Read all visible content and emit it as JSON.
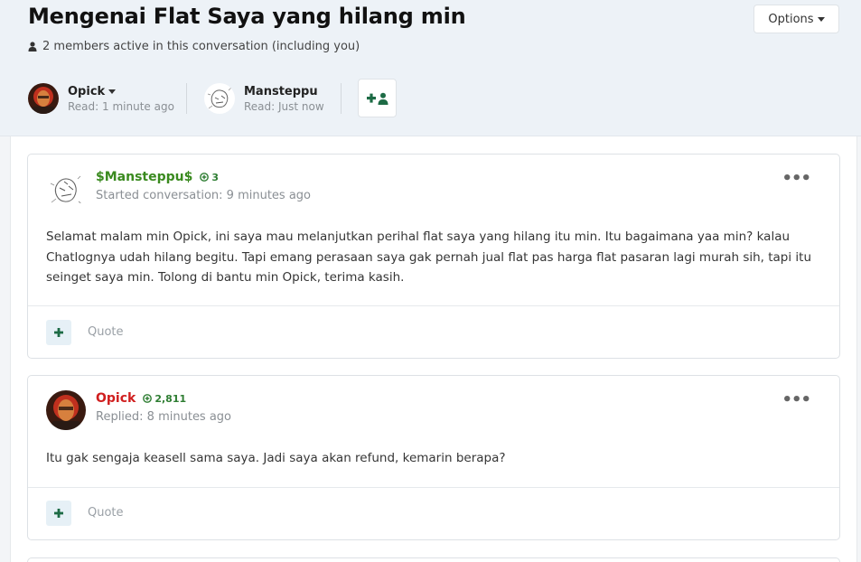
{
  "conversation": {
    "title": "Mengenai Flat Saya yang hilang min",
    "options_label": "Options",
    "active_members": "2 members active in this conversation (including you)",
    "members": [
      {
        "name": "Opick",
        "read": "Read: 1 minute ago"
      },
      {
        "name": "Mansteppu",
        "read": "Read: Just now"
      }
    ]
  },
  "messages": [
    {
      "author": "$Mansteppu$",
      "author_color": "#3a8a1f",
      "reputation": "3",
      "meta": "Started conversation: 9 minutes ago",
      "body": "Selamat malam min Opick, ini saya mau melanjutkan perihal flat saya yang hilang itu min. Itu bagaimana yaa min? kalau Chatlognya udah hilang begitu. Tapi emang perasaan saya gak pernah jual flat pas harga flat pasaran lagi murah sih, tapi itu seinget saya min. Tolong di bantu min Opick, terima kasih.",
      "quote_label": "Quote"
    },
    {
      "author": "Opick",
      "author_color": "#d01f1f",
      "reputation": "2,811",
      "meta": "Replied: 8 minutes ago",
      "body": "Itu gak sengaja keasell sama saya. Jadi saya akan refund, kemarin berapa?",
      "quote_label": "Quote"
    }
  ],
  "icons": {
    "user": "user-icon",
    "caret": "caret-down-icon",
    "invite": "add-user-icon",
    "more": "more-options-icon",
    "plus": "plus-icon",
    "rep": "reputation-icon"
  },
  "colors": {
    "accent": "#1d6b45",
    "rep_green": "#2e7d32"
  }
}
